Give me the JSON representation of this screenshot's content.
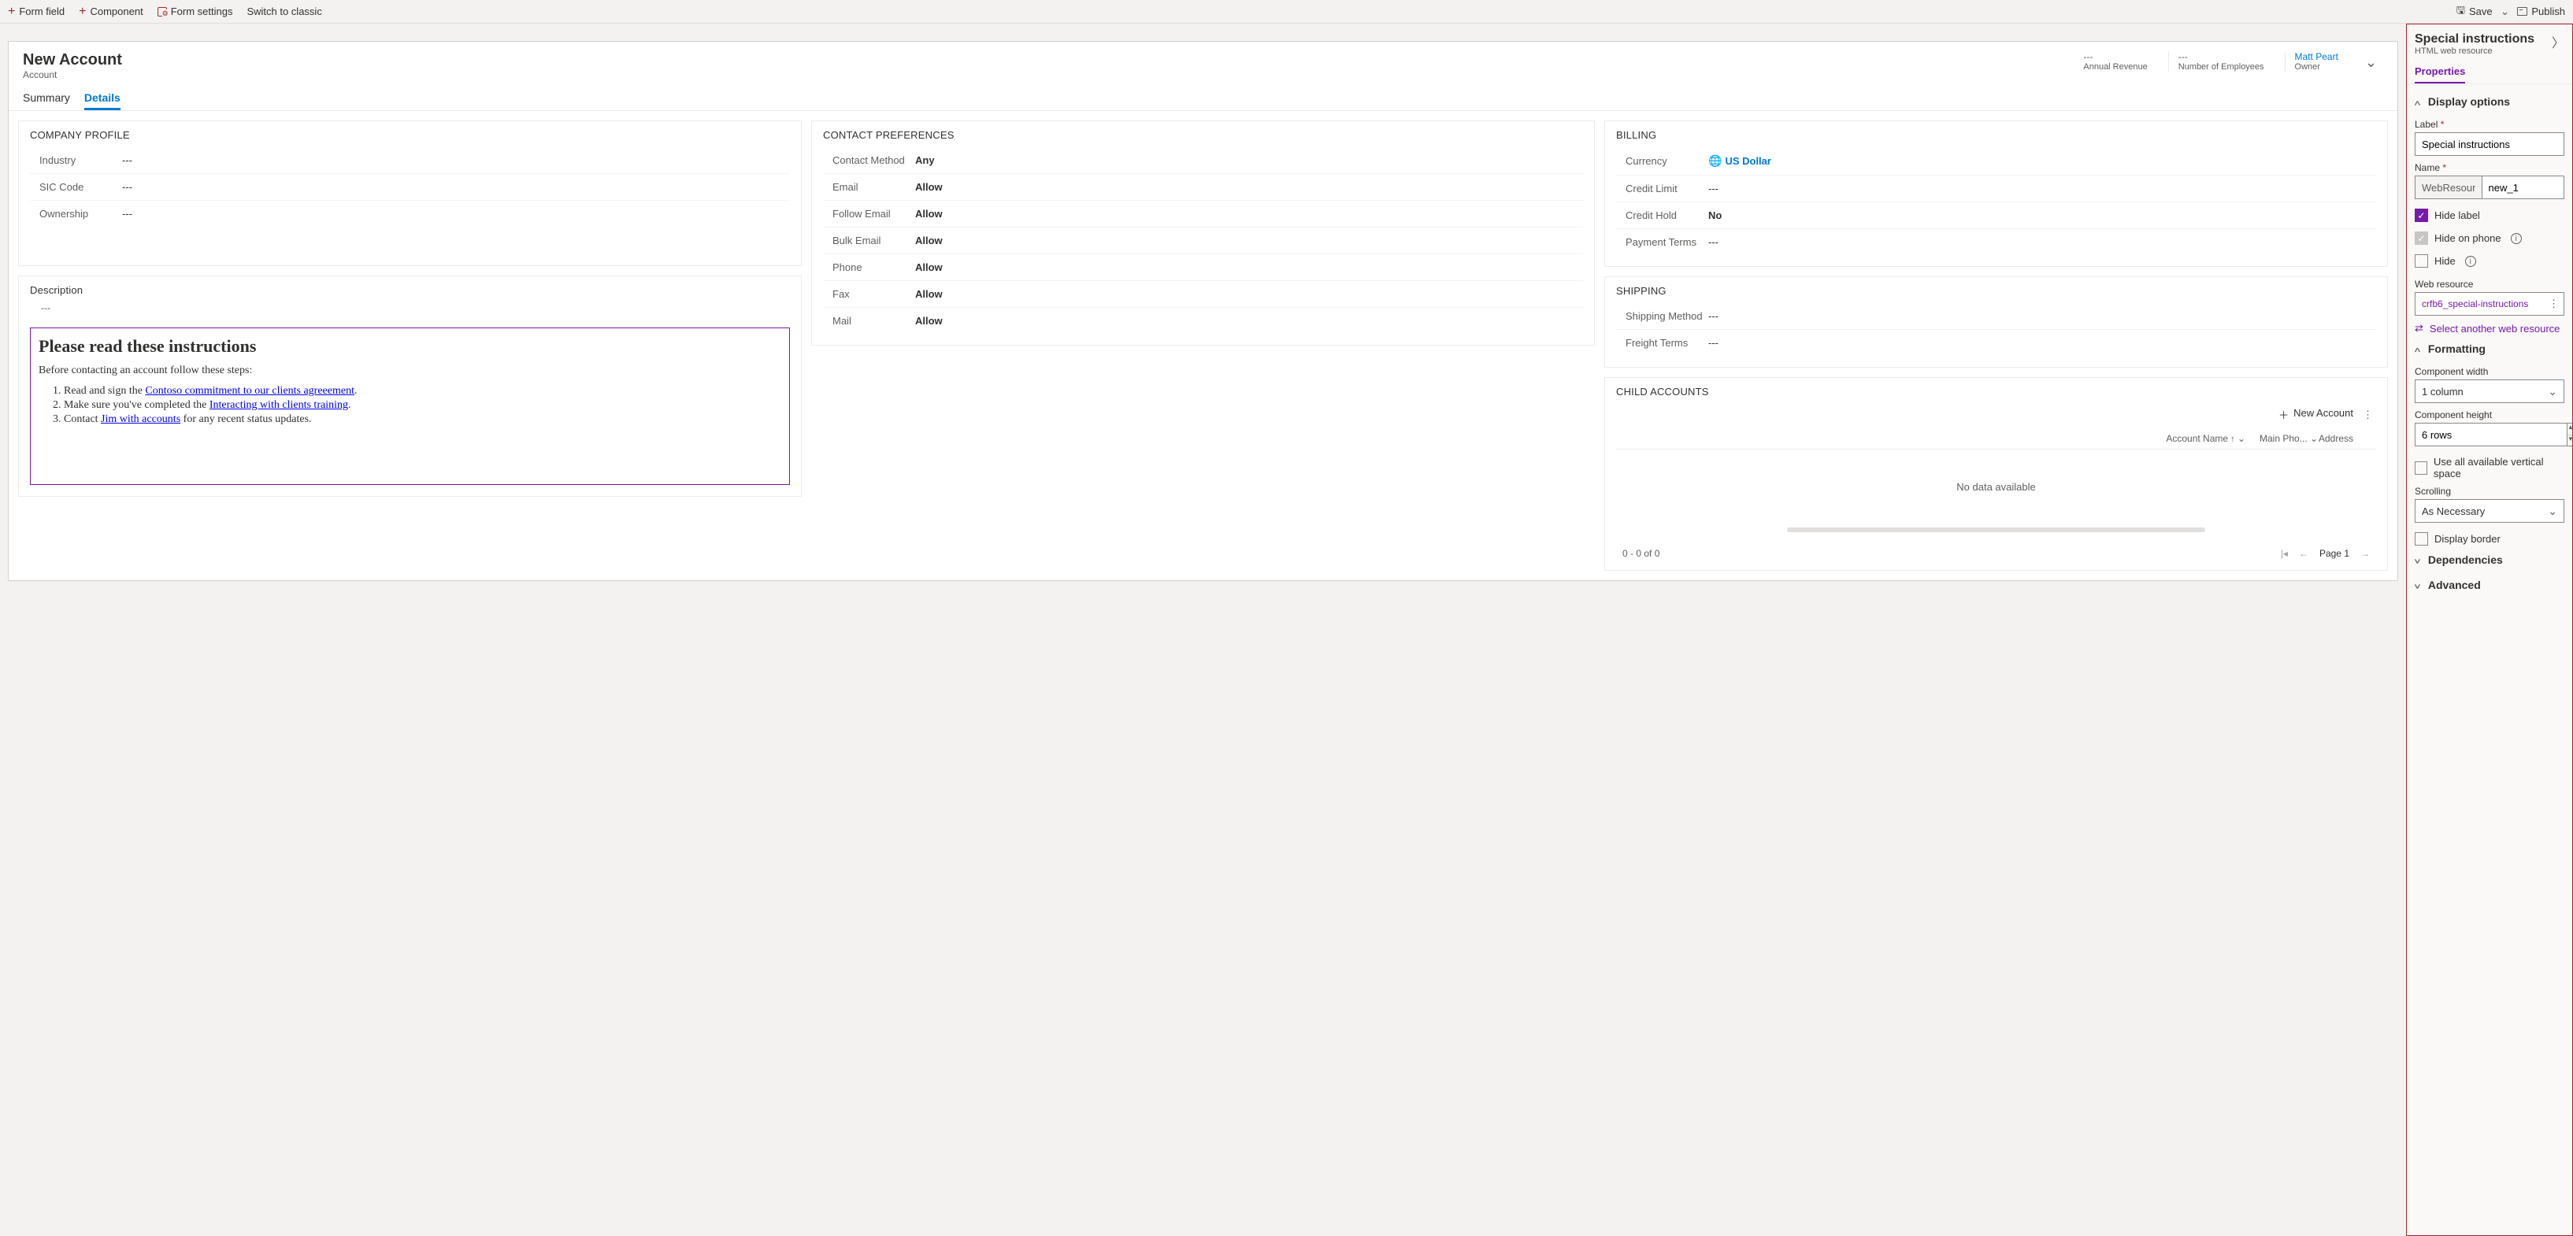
{
  "toolbar": {
    "form_field": "Form field",
    "component": "Component",
    "form_settings": "Form settings",
    "switch_classic": "Switch to classic",
    "save": "Save",
    "publish": "Publish"
  },
  "form": {
    "title": "New Account",
    "subtitle": "Account",
    "header_cells": [
      {
        "value": "---",
        "label": "Annual Revenue"
      },
      {
        "value": "---",
        "label": "Number of Employees"
      }
    ],
    "owner": {
      "value": "Matt Peart",
      "label": "Owner"
    },
    "tabs": [
      "Summary",
      "Details"
    ],
    "active_tab": "Details"
  },
  "company_profile": {
    "title": "COMPANY PROFILE",
    "rows": [
      {
        "label": "Industry",
        "value": "---"
      },
      {
        "label": "SIC Code",
        "value": "---"
      },
      {
        "label": "Ownership",
        "value": "---"
      }
    ]
  },
  "description": {
    "title": "Description",
    "value": "---"
  },
  "webres": {
    "heading": "Please read these instructions",
    "intro": "Before contacting an account follow these steps:",
    "li1_pre": "Read and sign the ",
    "li1_link": "Contoso commitment to our clients agreeement",
    "li2_pre": "Make sure you've completed the ",
    "li2_link": "Interacting with clients training",
    "li3_pre": "Contact ",
    "li3_link": "Jim with accounts",
    "li3_post": " for any recent status updates."
  },
  "contact_prefs": {
    "title": "CONTACT PREFERENCES",
    "rows": [
      {
        "label": "Contact Method",
        "value": "Any"
      },
      {
        "label": "Email",
        "value": "Allow"
      },
      {
        "label": "Follow Email",
        "value": "Allow"
      },
      {
        "label": "Bulk Email",
        "value": "Allow"
      },
      {
        "label": "Phone",
        "value": "Allow"
      },
      {
        "label": "Fax",
        "value": "Allow"
      },
      {
        "label": "Mail",
        "value": "Allow"
      }
    ]
  },
  "billing": {
    "title": "BILLING",
    "currency_label": "Currency",
    "currency_value": "US Dollar",
    "rows": [
      {
        "label": "Credit Limit",
        "value": "---"
      },
      {
        "label": "Credit Hold",
        "value": "No"
      },
      {
        "label": "Payment Terms",
        "value": "---"
      }
    ]
  },
  "shipping": {
    "title": "SHIPPING",
    "rows": [
      {
        "label": "Shipping Method",
        "value": "---"
      },
      {
        "label": "Freight Terms",
        "value": "---"
      }
    ]
  },
  "child_accounts": {
    "title": "CHILD ACCOUNTS",
    "add": "New Account",
    "cols": {
      "name": "Account Name",
      "phone": "Main Pho...",
      "address": "Address"
    },
    "empty": "No data available",
    "count": "0 - 0 of 0",
    "page": "Page 1"
  },
  "panel": {
    "title": "Special instructions",
    "subtitle": "HTML web resource",
    "tab": "Properties",
    "display_options": "Display options",
    "label_lbl": "Label",
    "label_val": "Special instructions",
    "name_lbl": "Name",
    "name_prefix": "WebResource_",
    "name_val": "new_1",
    "hide_label": "Hide label",
    "hide_on_phone": "Hide on phone",
    "hide": "Hide",
    "web_resource_lbl": "Web resource",
    "web_resource_val": "crfb6_special-instructions",
    "select_another": "Select another web resource",
    "formatting": "Formatting",
    "comp_width_lbl": "Component width",
    "comp_width_val": "1 column",
    "comp_height_lbl": "Component height",
    "comp_height_val": "6 rows",
    "use_all_space": "Use all available vertical space",
    "scrolling_lbl": "Scrolling",
    "scrolling_val": "As Necessary",
    "display_border": "Display border",
    "dependencies": "Dependencies",
    "advanced": "Advanced"
  }
}
